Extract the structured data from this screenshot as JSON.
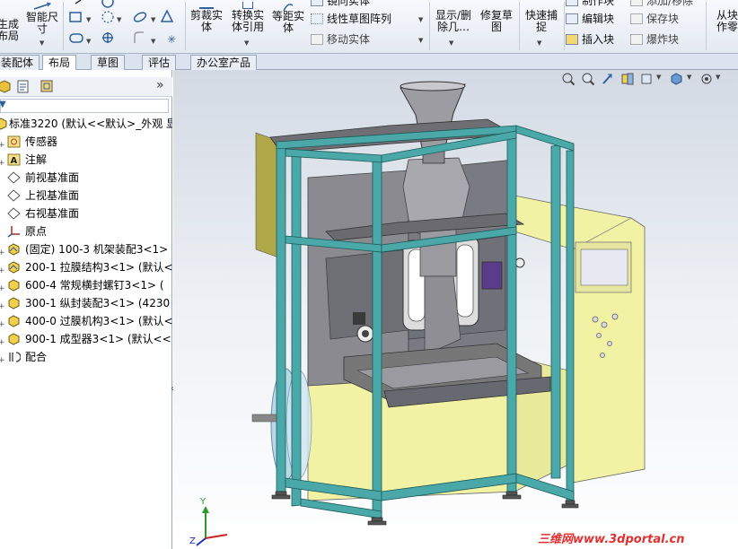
{
  "ribbon": {
    "col1_label": "生成\n布局",
    "smart_dim_label": "智能尺\n寸",
    "trim_label": "剪裁实\n体",
    "convert_label": "转换实\n体引用",
    "offset_label": "等距实\n体",
    "mirror_label": "镜向实体",
    "linear_pattern_label": "线性草图阵列",
    "move_label": "移动实体",
    "display_delete_label": "显示/删\n除几…",
    "repair_label": "修复草\n图",
    "quick_snap_label": "快速捕\n捉",
    "make_block_label": "制作块",
    "edit_block_label": "编辑块",
    "insert_block_label": "插入块",
    "add_remove_label": "添加/移除",
    "save_block_label": "保存块",
    "explode_block_label": "爆炸块",
    "from_block_label": "从块\n作零"
  },
  "tabs": [
    {
      "label": "装配体",
      "active": false
    },
    {
      "label": "布局",
      "active": true
    },
    {
      "label": "草图",
      "active": false
    },
    {
      "label": "评估",
      "active": false
    },
    {
      "label": "办公室产品",
      "active": false
    }
  ],
  "left_panel": {
    "expand_chevron": "»",
    "filter_caret": "▼",
    "tree": [
      {
        "label": "标准3220 (默认<<默认>_外观 显",
        "icon": "assembly-icon"
      },
      {
        "label": "传感器",
        "icon": "sensor-icon"
      },
      {
        "label": "注解",
        "icon": "annotation-icon"
      },
      {
        "label": "前视基准面",
        "icon": "plane-icon"
      },
      {
        "label": "上视基准面",
        "icon": "plane-icon"
      },
      {
        "label": "右视基准面",
        "icon": "plane-icon"
      },
      {
        "label": "原点",
        "icon": "origin-icon"
      },
      {
        "label": "(固定) 100-3  机架装配3<1>",
        "icon": "subassembly-icon"
      },
      {
        "label": "200-1  拉膜结构3<1> (默认<",
        "icon": "subassembly-icon"
      },
      {
        "label": "600-4   常规横封螺钉3<1> (",
        "icon": "subassembly-icon"
      },
      {
        "label": "300-1  纵封装配3<1> (4230",
        "icon": "subassembly-icon"
      },
      {
        "label": "400-0  过膜机构3<1> (默认<",
        "icon": "subassembly-icon"
      },
      {
        "label": "900-1  成型器3<1> (默认<<",
        "icon": "subassembly-icon"
      },
      {
        "label": "配合",
        "icon": "mates-icon"
      }
    ]
  },
  "viewport": {
    "watermark": "三维网www.3dportal.cn",
    "axis_labels": {
      "y": "Y",
      "z": "Z"
    }
  },
  "colors": {
    "frame_teal": "#4aa8a8",
    "panel_yellow": "#f0f0a0",
    "plate_gray": "#7d7d82",
    "hopper_gray": "#9a9aa0"
  }
}
